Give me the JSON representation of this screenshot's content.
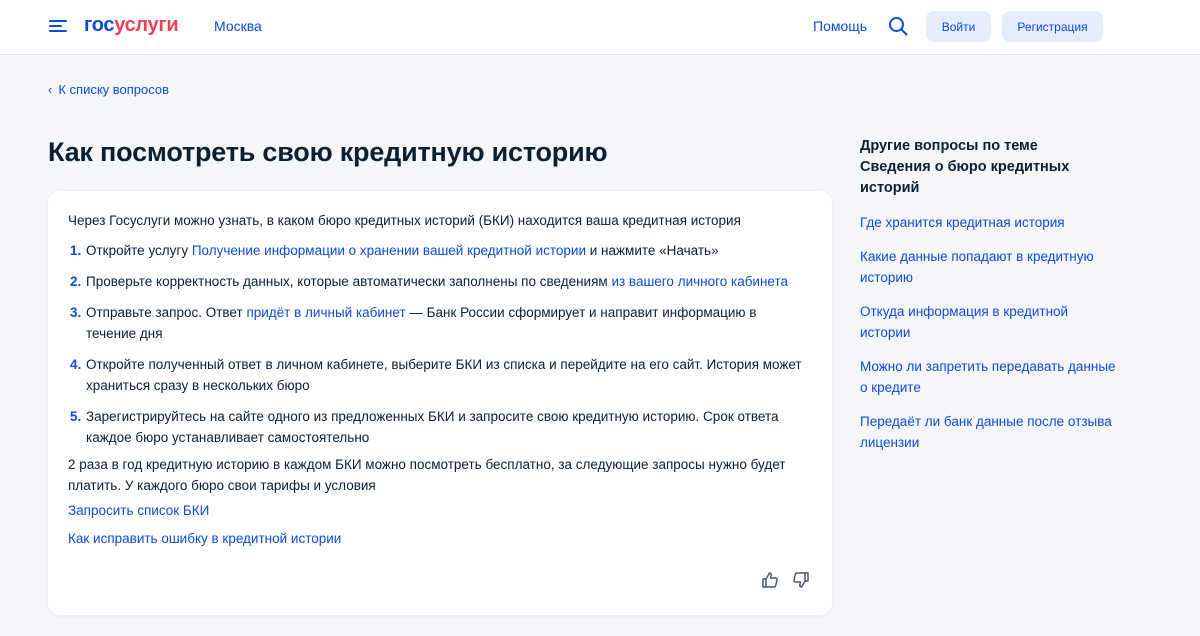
{
  "header": {
    "logo_part1": "гос",
    "logo_part2": "услуги",
    "city": "Москва",
    "help": "Помощь",
    "login": "Войти",
    "register": "Регистрация"
  },
  "breadcrumb": {
    "back_label": "К списку вопросов"
  },
  "page_title": "Как посмотреть свою кредитную историю",
  "article": {
    "intro": "Через Госуслуги можно узнать, в каком бюро кредитных историй (БКИ) находится ваша кредитная история",
    "steps": [
      {
        "num": "1.",
        "before": "Откройте услугу ",
        "link": "Получение информации о хранении вашей кредитной истории",
        "after": " и нажмите «Начать»"
      },
      {
        "num": "2.",
        "before": "Проверьте корректность данных, которые автоматически заполнены по сведениям ",
        "link": "из вашего личного кабинета",
        "after": ""
      },
      {
        "num": "3.",
        "before": "Отправьте запрос. Ответ ",
        "link": "придёт в личный кабинет",
        "after": " — Банк России сформирует и направит информацию в течение дня"
      },
      {
        "num": "4.",
        "text": "Откройте полученный ответ в личном кабинете, выберите БКИ из списка и перейдите на его сайт. История может храниться сразу в нескольких бюро"
      },
      {
        "num": "5.",
        "text": "Зарегистрируйтесь на сайте одного из предложенных БКИ и запросите свою кредитную историю. Срок ответа каждое бюро устанавливает самостоятельно"
      }
    ],
    "note": "2 раза в год кредитную историю в каждом БКИ можно посмотреть бесплатно, за следующие запросы нужно будет платить. У каждого бюро свои тарифы и условия",
    "links": [
      "Запросить список БКИ",
      "Как исправить ошибку в кредитной истории"
    ],
    "feedback": {
      "like_icon": "thumbs-up-icon",
      "dislike_icon": "thumbs-down-icon"
    }
  },
  "aside": {
    "title": "Другие вопросы по теме Сведения о бюро кредитных историй",
    "links": [
      "Где хранится кредитная история",
      "Какие данные попадают в кредитную историю",
      "Откуда информация в кредитной истории",
      "Можно ли запретить передавать данные о кредите",
      "Передаёт ли банк данные после отзыва лицензии"
    ]
  },
  "colors": {
    "brand_blue": "#0d4cd3",
    "brand_red": "#ee3f58",
    "text": "#0b1f33",
    "button_bg": "#e4ecfd",
    "page_bg": "#f4f6f9"
  }
}
